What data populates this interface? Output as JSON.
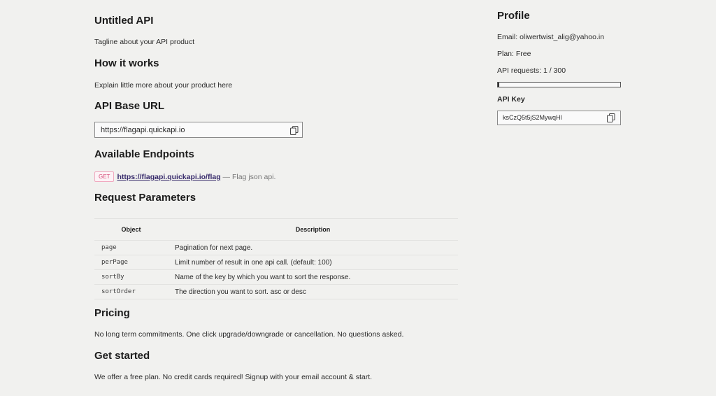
{
  "main": {
    "title": "Untitled API",
    "tagline": "Tagline about your API product",
    "how_heading": "How it works",
    "how_text": "Explain little more about your product here",
    "base_url_heading": "API Base URL",
    "base_url": "https://flagapi.quickapi.io",
    "endpoints_heading": "Available Endpoints",
    "endpoint": {
      "method": "GET",
      "url": "https://flagapi.quickapi.io/flag",
      "description": " — Flag json api."
    },
    "params_heading": "Request Parameters",
    "params_table": {
      "headers": [
        "Object",
        "Description"
      ],
      "rows": [
        {
          "name": "page",
          "desc": "Pagination for next page."
        },
        {
          "name": "perPage",
          "desc": "Limit number of result in one api call. (default: 100)"
        },
        {
          "name": "sortBy",
          "desc": "Name of the key by which you want to sort the response."
        },
        {
          "name": "sortOrder",
          "desc": "The direction you want to sort. asc or desc"
        }
      ]
    },
    "pricing_heading": "Pricing",
    "pricing_text": "No long term commitments. One click upgrade/downgrade or cancellation. No questions asked.",
    "get_started_heading": "Get started",
    "get_started_text": "We offer a free plan. No credit cards required! Signup with your email account & start."
  },
  "profile": {
    "heading": "Profile",
    "email": "Email: oliwertwist_alig@yahoo.in",
    "plan": "Plan: Free",
    "requests": "API requests: 1 / 300",
    "requests_used": 1,
    "requests_limit": 300,
    "api_key_label": "API Key",
    "api_key": "ksCzQ5t5jS2MywqHl"
  },
  "icons": {
    "copy": "copy-icon"
  }
}
